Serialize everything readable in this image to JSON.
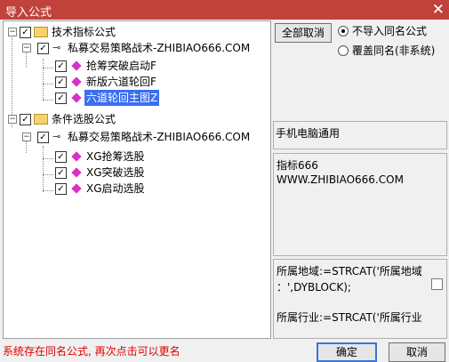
{
  "window": {
    "title": "导入公式",
    "close_glyph": "✕"
  },
  "tree": {
    "groups": [
      {
        "label": "技术指标公式",
        "author": "私募交易策略战术-ZHIBIAO666.COM",
        "items": [
          "抢筹突破启动F",
          "新版六道轮回F",
          "六道轮回主图Z"
        ]
      },
      {
        "label": "条件选股公式",
        "author": "私募交易策略战术-ZHIBIAO666.COM",
        "items": [
          "XG抢筹选股",
          "XG突破选股",
          "XG启动选股"
        ]
      }
    ]
  },
  "buttons": {
    "cancel_all": "全部取消",
    "ok": "确定",
    "cancel": "取消"
  },
  "options": {
    "no_import_same": "不导入同名公式",
    "overwrite_same": "覆盖同名(非系统)",
    "selected": "no_import_same"
  },
  "info": {
    "platform": "手机电脑通用",
    "desc_line1": "指标666",
    "desc_line2": "WWW.ZHIBIAO666.COM",
    "code_line1": "所属地域:=STRCAT('所属地域",
    "code_line2": "：',DYBLOCK);",
    "code_line3": "所属行业:=STRCAT('所属行业"
  },
  "status": "系统存在同名公式, 再次点击可以更名"
}
